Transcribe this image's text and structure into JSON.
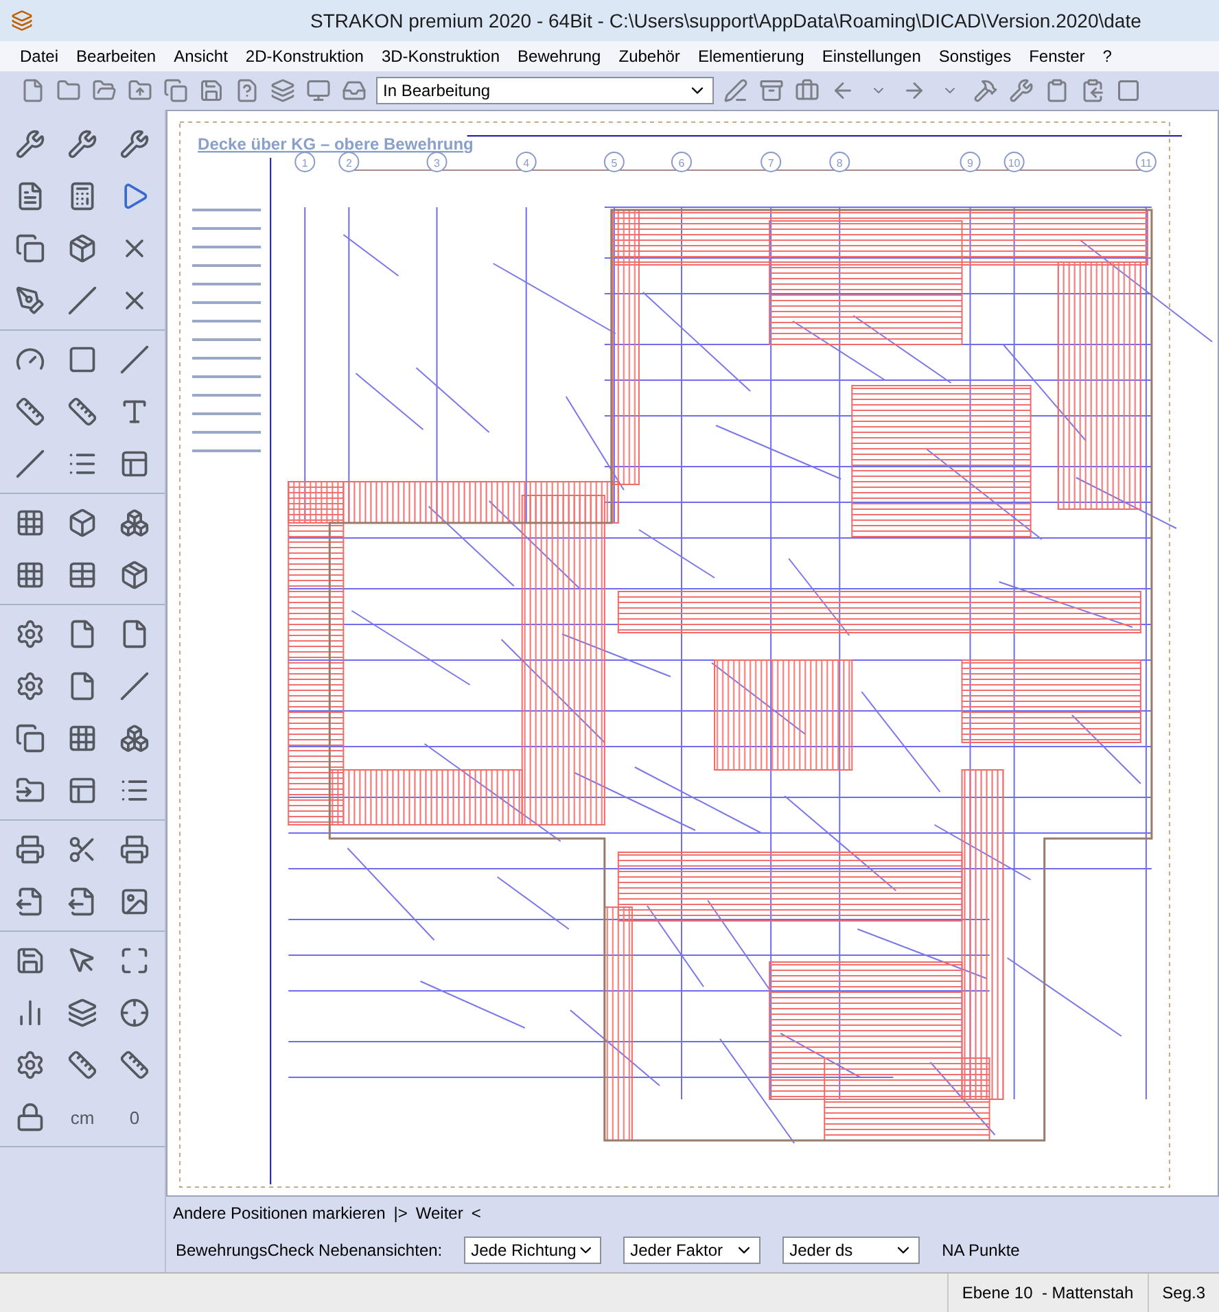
{
  "window": {
    "title": "STRAKON premium 2020  - 64Bit  - C:\\Users\\support\\AppData\\Roaming\\DICAD\\Version.2020\\date"
  },
  "menu": [
    "Datei",
    "Bearbeiten",
    "Ansicht",
    "2D-Konstruktion",
    "3D-Konstruktion",
    "Bewehrung",
    "Zubehör",
    "Elementierung",
    "Einstellungen",
    "Sonstiges",
    "Fenster",
    "?"
  ],
  "toolbar": {
    "status_select": {
      "value": "In Bearbeitung"
    }
  },
  "side_toolbar": {
    "unit": "cm",
    "counter": "0"
  },
  "drawing": {
    "title": "Decke über KG – obere Bewehrung",
    "axes": [
      "1",
      "2",
      "3",
      "4",
      "5",
      "6",
      "7",
      "8",
      "9",
      "10",
      "11"
    ]
  },
  "hint_bar": {
    "text": "Andere Positionen markieren",
    "next_marker": "|>",
    "next": "Weiter",
    "back": "<"
  },
  "check_bar": {
    "label": "BewehrungsCheck Nebenansichten:",
    "selects": [
      {
        "value": "Jede Richtung"
      },
      {
        "value": "Jeder Faktor"
      },
      {
        "value": "Jeder ds"
      }
    ],
    "points": "NA Punkte"
  },
  "status_bar": {
    "layer": "Ebene 10",
    "mode": "- Mattenstah",
    "segment": "Seg.3"
  }
}
